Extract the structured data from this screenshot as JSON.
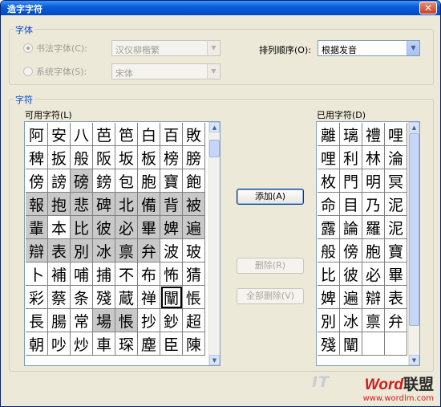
{
  "window": {
    "title": "造字字符",
    "close_glyph": "✕"
  },
  "font_group": {
    "label": "字体",
    "calligraphy_radio": "书法字体(C):",
    "calligraphy_value": "汉仪柳楷繁",
    "system_radio": "系统字体(S):",
    "system_value": "宋体"
  },
  "sort": {
    "label": "排列顺序(O):",
    "value": "根据发音"
  },
  "chars_group": {
    "label": "字符"
  },
  "available": {
    "label": "可用字符(L)",
    "rows": [
      [
        "阿",
        "安",
        "八",
        "芭",
        "笆",
        "白",
        "百",
        "敗"
      ],
      [
        "稗",
        "扳",
        "般",
        "阪",
        "坂",
        "板",
        "榜",
        "膀"
      ],
      [
        "傍",
        "謗",
        "磅",
        "鎊",
        "包",
        "胞",
        "寶",
        "飽"
      ],
      [
        "報",
        "抱",
        "悲",
        "碑",
        "北",
        "備",
        "背",
        "被"
      ],
      [
        "輩",
        "本",
        "比",
        "彼",
        "必",
        "畢",
        "婢",
        "遍"
      ],
      [
        "辯",
        "表",
        "別",
        "冰",
        "禀",
        "弁",
        "波",
        "玻"
      ],
      [
        "卜",
        "補",
        "哺",
        "捕",
        "不",
        "布",
        "怖",
        "猜"
      ],
      [
        "彩",
        "蔡",
        "条",
        "殘",
        "蔵",
        "禅",
        "闡",
        "悵"
      ],
      [
        "長",
        "腸",
        "常",
        "場",
        "悵",
        "抄",
        "鈔",
        "超"
      ],
      [
        "朝",
        "吵",
        "炒",
        "車",
        "琛",
        "塵",
        "臣",
        "陳"
      ]
    ],
    "gray": [
      "2-2",
      "3-0",
      "3-1",
      "3-2",
      "3-3",
      "3-4",
      "3-5",
      "3-6",
      "3-7",
      "4-0",
      "4-2",
      "4-3",
      "4-4",
      "4-5",
      "4-6",
      "4-7",
      "5-0",
      "5-1",
      "5-2",
      "5-3",
      "5-4",
      "5-5",
      "8-3",
      "8-4"
    ],
    "selected": "7-6"
  },
  "used": {
    "label": "已用字符(D)",
    "rows": [
      [
        "離",
        "璃",
        "禮",
        "哩"
      ],
      [
        "哩",
        "利",
        "林",
        "淪"
      ],
      [
        "枚",
        "門",
        "明",
        "冥"
      ],
      [
        "命",
        "目",
        "乃",
        "泥"
      ],
      [
        "露",
        "論",
        "羅",
        "泥"
      ],
      [
        "般",
        "傍",
        "胞",
        "寶"
      ],
      [
        "比",
        "彼",
        "必",
        "畢"
      ],
      [
        "婢",
        "遍",
        "辯",
        "表"
      ],
      [
        "別",
        "冰",
        "禀",
        "弁"
      ],
      [
        "殘",
        "闡",
        "",
        ""
      ]
    ]
  },
  "buttons": {
    "add": "添加(A)",
    "delete": "删除(R)",
    "delete_all": "全部删除(V)"
  },
  "watermark": {
    "brand_prefix": "Word",
    "brand_suffix": "联盟",
    "url": "www.wordlm.com",
    "it_mark": "IT"
  },
  "colors": {
    "title_bar": "#0a5fd8",
    "group_label": "#0046d5",
    "dialog_bg": "#ece9d8",
    "gray_cell": "#c9c9c9"
  }
}
